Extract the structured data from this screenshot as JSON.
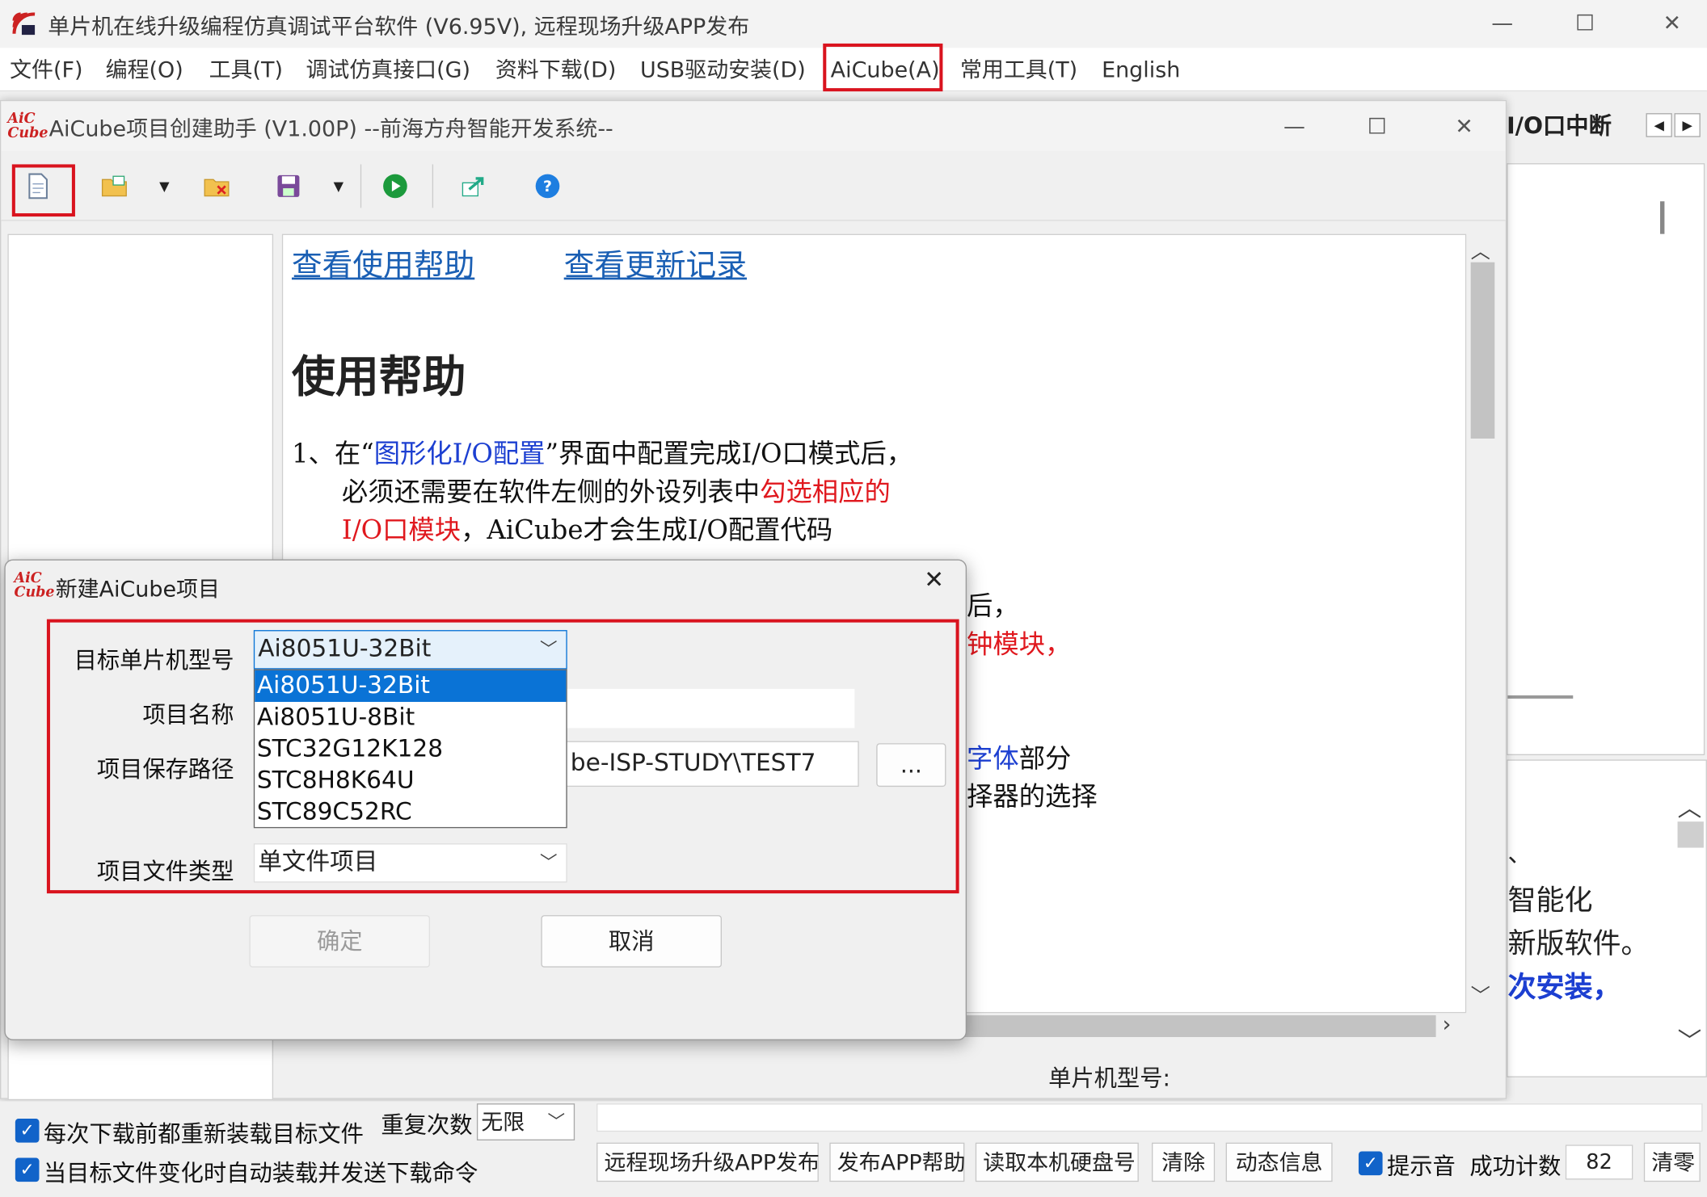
{
  "main_window": {
    "title": "单片机在线升级编程仿真调试平台软件 (V6.95V), 远程现场升级APP发布",
    "controls": {
      "minimize": "—",
      "maximize": "☐",
      "close": "✕"
    }
  },
  "menubar": {
    "items": [
      "文件(F)",
      "编程(O)",
      "工具(T)",
      "调试仿真接口(G)",
      "资料下载(D)",
      "USB驱动安装(D)",
      "AiCube(A)",
      "常用工具(T)",
      "English"
    ]
  },
  "right_pane": {
    "tab_label": "I/O口中断",
    "text_lines": [
      "、",
      "智能化",
      "新版软件。",
      "次安装，"
    ]
  },
  "aicube_window": {
    "title": "AiCube项目创建助手 (V1.00P) --前海方舟智能开发系统--",
    "logo_text": "AiC Cube",
    "links": [
      "查看使用帮助",
      "查看更新记录"
    ],
    "heading": "使用帮助",
    "paragraph1": {
      "line1_a": "1、在“",
      "line1_link": "图形化I/O配置",
      "line1_b": "”界面中配置完成I/O口模式后，",
      "line2_a": "必须还需要在软件左侧的外设列表中",
      "line2_red": "勾选相应的",
      "line3_red": "I/O口模块",
      "line3_b": "，AiCube才会生成I/O配置代码"
    },
    "partial_lines": [
      "后，",
      "钟模块，",
      "字体",
      "部分",
      "择器的选择"
    ]
  },
  "dialog": {
    "title": "新建AiCube项目",
    "labels": {
      "mcu": "目标单片机型号",
      "name": "项目名称",
      "path": "项目保存路径",
      "type": "项目文件类型"
    },
    "mcu_selected": "Ai8051U-32Bit",
    "mcu_options": [
      "Ai8051U-32Bit",
      "Ai8051U-8Bit",
      "STC32G12K128",
      "STC8H8K64U",
      "STC89C52RC"
    ],
    "path_value": "be-ISP-STUDY\\TEST7",
    "browse_label": "...",
    "type_value": "单文件项目",
    "ok_label": "确定",
    "cancel_label": "取消"
  },
  "status": {
    "mcu_label": "单片机型号:"
  },
  "bottom": {
    "check1": "每次下载前都重新装载目标文件",
    "check2": "当目标文件变化时自动装载并发送下载命令",
    "repeat_label": "重复次数",
    "repeat_value": "无限",
    "buttons": [
      "远程现场升级APP发布",
      "发布APP帮助",
      "读取本机硬盘号",
      "清除",
      "动态信息"
    ],
    "sound_label": "提示音",
    "count_label": "成功计数",
    "count_value": "82",
    "clear_label": "清零"
  },
  "colors": {
    "accent": "#0a73d6",
    "highlight_box": "#d9131e",
    "link": "#1a5fb4",
    "text_red": "#e0181e",
    "text_blue": "#1c3fd1"
  }
}
